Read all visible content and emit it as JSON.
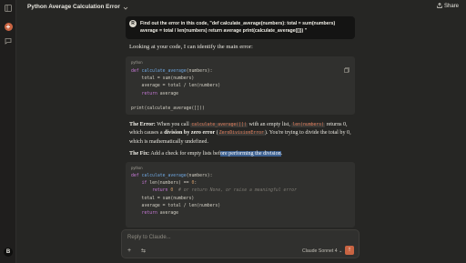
{
  "app": {
    "avatar_letter": "B"
  },
  "header": {
    "title": "Python Average Calculation Error",
    "share_label": "Share"
  },
  "user_message": {
    "avatar_letter": "R",
    "text": "Find out the error in this code, \"def calculate_average(numbers): total = sum(numbers) average = total / len(numbers) return average print(calculate_average([])) \""
  },
  "response": {
    "intro": "Looking at your code, I can identify the main error:",
    "code1_lang": "python",
    "error_label": "The Error:",
    "error_t1": " When you call ",
    "error_code1": "calculate_average([])",
    "error_t2": " with an empty list, ",
    "error_code2": "len(numbers)",
    "error_t3": " returns 0, which causes a ",
    "error_bold": "division by zero error",
    "error_t4": " (",
    "error_code3": "ZeroDivisionError",
    "error_t5": "). You're trying to divide the total by 0, which is mathematically undefined.",
    "fix_label": "The Fix:",
    "fix_t1": " Add a check for empty lists bef",
    "fix_highlight": "ore performing the division",
    "fix_t2": ".",
    "code2_lang": "python"
  },
  "composer": {
    "placeholder": "Reply to Claude...",
    "plus": "+",
    "tools": "⇆",
    "model": "Claude Sonnet 4",
    "send": "↑"
  },
  "colors": {
    "accent": "#c96442",
    "highlight": "#3b5f8f",
    "inline_code": "#d97757"
  },
  "icons": [
    "sidebar-toggle-icon",
    "new-chat-icon",
    "chats-icon",
    "chevron-down-icon",
    "share-icon",
    "copy-icon",
    "plus-icon",
    "tools-icon",
    "send-icon"
  ]
}
